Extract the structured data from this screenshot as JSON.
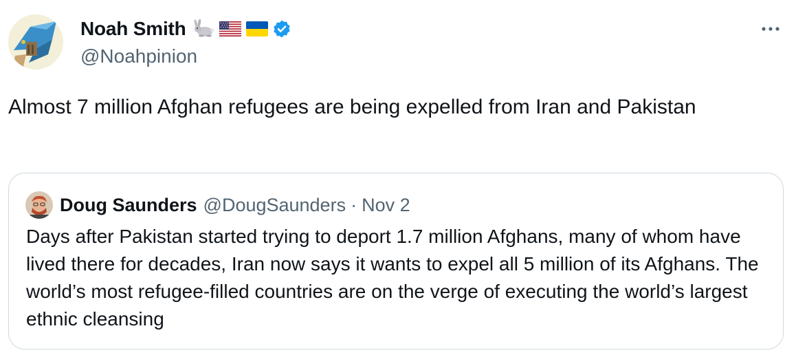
{
  "tweet": {
    "author": {
      "display_name": "Noah Smith",
      "handle": "@Noahpinion",
      "badges": [
        "rabbit-emoji",
        "us-flag-emoji",
        "ukraine-flag-emoji",
        "verified-badge"
      ]
    },
    "more_icon": "more-horizontal-icon",
    "text": "Almost 7 million Afghan refugees are being expelled from Iran and Pakistan",
    "quoted_tweet": {
      "author": {
        "display_name": "Doug Saunders",
        "handle": "@DougSaunders",
        "separator": "·",
        "date": "Nov 2"
      },
      "text": "Days after Pakistan started trying to deport 1.7 million Afghans, many of whom have lived there for decades, Iran now says it wants to expel all 5 million of its Afghans. The world’s most refugee-filled countries are on the verge of executing the world’s largest ethnic cleansing"
    }
  },
  "colors": {
    "text": "#0f1419",
    "secondary": "#536471",
    "border": "#cfd9de",
    "verified": "#1d9bf0"
  }
}
